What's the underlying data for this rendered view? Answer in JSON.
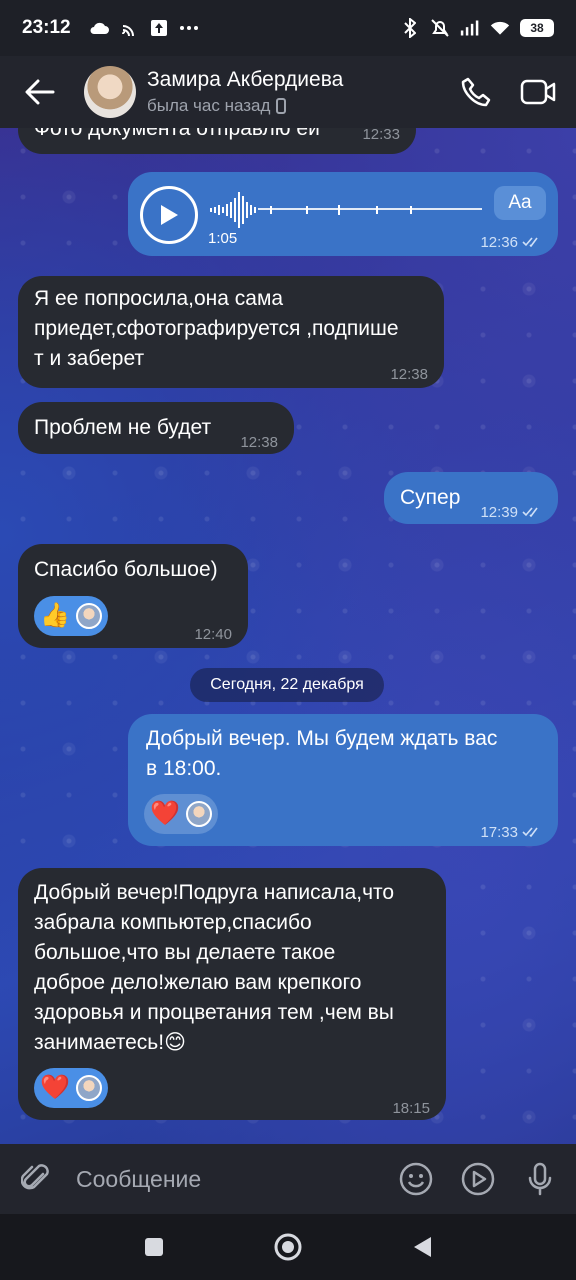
{
  "status_bar": {
    "time": "23:12",
    "battery": "38",
    "icons": [
      "cloud-icon",
      "cast-icon",
      "upload-icon",
      "more-dots-icon",
      "bluetooth-icon",
      "silent-icon",
      "signal-icon",
      "wifi-icon",
      "battery-icon"
    ]
  },
  "header": {
    "name": "Замира Акбердиева",
    "status": "была час назад"
  },
  "messages": {
    "m0": {
      "text": "Фото документа отправлю ей",
      "time": "12:33"
    },
    "voice": {
      "duration": "1:05",
      "time": "12:36",
      "aa": "Aa"
    },
    "m1": {
      "line1": "Я ее попросила,она сама",
      "line2": "приедет,сфотографируется ,подпише",
      "line3": "т и заберет",
      "time": "12:38"
    },
    "m2": {
      "text": "Проблем не будет",
      "time": "12:38"
    },
    "m3": {
      "text": "Супер",
      "time": "12:39"
    },
    "m4": {
      "text": "Спасибо большое)",
      "time": "12:40",
      "reaction": "👍"
    },
    "date_separator": "Сегодня, 22 декабря",
    "m5": {
      "line1": "Добрый вечер. Мы будем ждать вас",
      "line2": "в 18:00.",
      "time": "17:33",
      "reaction": "❤️"
    },
    "m6": {
      "line1": "Добрый вечер!Подруга написала,что",
      "line2": "забрала компьютер,спасибо",
      "line3": "большое,что вы делаете такое",
      "line4": "доброе дело!желаю вам крепкого",
      "line5": "здоровья и процветания тем ,чем вы",
      "line6": "занимаетесь!😊",
      "time": "18:15",
      "reaction": "❤️"
    }
  },
  "input": {
    "placeholder": "Сообщение"
  },
  "colors": {
    "outgoing": "#3a73c7",
    "incoming": "#272a31",
    "reaction": "#4a8fe6"
  }
}
